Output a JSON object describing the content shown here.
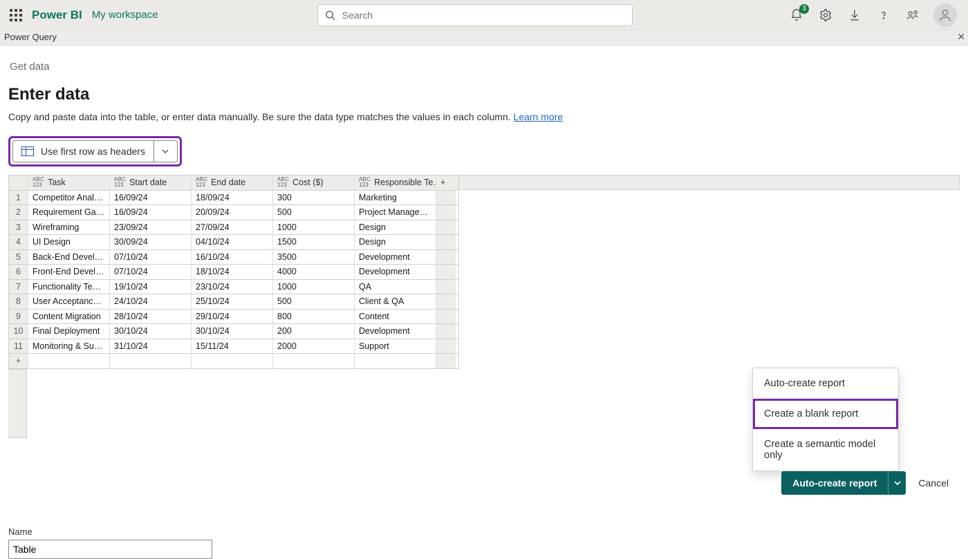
{
  "topbar": {
    "brand": "Power BI",
    "workspace": "My workspace",
    "search_placeholder": "Search",
    "notif_count": "3"
  },
  "secondbar": {
    "title": "Power Query"
  },
  "page": {
    "getdata": "Get data",
    "title": "Enter data",
    "subtitle_pre": "Copy and paste data into the table, or enter data manually. Be sure the data type matches the values in each column. ",
    "learn_more": "Learn more",
    "first_row_btn": "Use first row as headers",
    "name_label": "Name",
    "name_value": "Table"
  },
  "table": {
    "type_tag_top": "ABC",
    "type_tag_bottom": "123",
    "columns": [
      "Task",
      "Start date",
      "End date",
      "Cost ($)",
      "Responsible Te…"
    ],
    "rows": [
      [
        "Competitor Analysis",
        "16/09/24",
        "18/09/24",
        "300",
        "Marketing"
      ],
      [
        "Requirement Gathe…",
        "16/09/24",
        "20/09/24",
        "500",
        "Project Management"
      ],
      [
        "Wireframing",
        "23/09/24",
        "27/09/24",
        "1000",
        "Design"
      ],
      [
        "UI Design",
        "30/09/24",
        "04/10/24",
        "1500",
        "Design"
      ],
      [
        "Back-End Develop…",
        "07/10/24",
        "16/10/24",
        "3500",
        "Development"
      ],
      [
        "Front-End Develop…",
        "07/10/24",
        "18/10/24",
        "4000",
        "Development"
      ],
      [
        "Functionality Testing",
        "19/10/24",
        "23/10/24",
        "1000",
        "QA"
      ],
      [
        "User Acceptance T…",
        "24/10/24",
        "25/10/24",
        "500",
        "Client & QA"
      ],
      [
        "Content Migration",
        "28/10/24",
        "29/10/24",
        "800",
        "Content"
      ],
      [
        "Final Deployment",
        "30/10/24",
        "30/10/24",
        "200",
        "Development"
      ],
      [
        "Monitoring & Support",
        "31/10/24",
        "15/11/24",
        "2000",
        "Support"
      ]
    ],
    "add_col": "+",
    "add_row": "+"
  },
  "menu": {
    "opt1": "Auto-create report",
    "opt2": "Create a blank report",
    "opt3": "Create a semantic model only"
  },
  "footer": {
    "primary": "Auto-create report",
    "cancel": "Cancel"
  }
}
